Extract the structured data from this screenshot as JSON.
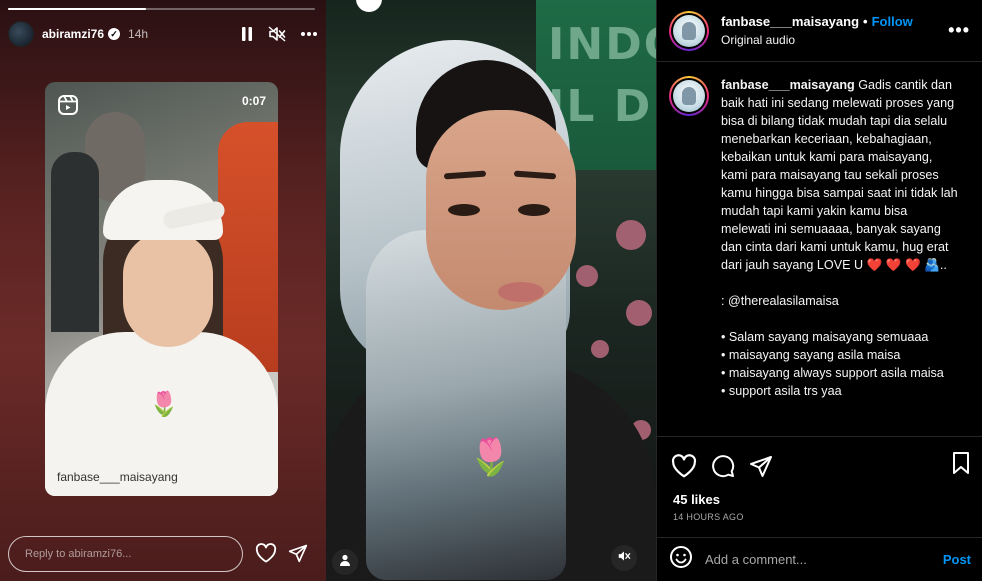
{
  "story": {
    "progress": 0.45,
    "username": "abiramzi76",
    "verified_mark": "✓",
    "time_ago": "14h",
    "controls": [
      "pause-icon",
      "muted-icon",
      "more-icon"
    ],
    "reel": {
      "duration": "0:07",
      "credit": "fanbase___maisayang",
      "sticker": "🌷"
    },
    "reply_placeholder": "Reply to abiramzi76..."
  },
  "media": {
    "sign_text": "INDO\nIL D",
    "sticker": "🌷"
  },
  "post": {
    "username": "fanbase___maisayang",
    "separator": "•",
    "follow_label": "Follow",
    "audio": "Original audio",
    "more": "•••",
    "caption": {
      "username": "fanbase___maisayang",
      "text": "Gadis cantik dan baik hati ini sedang melewati proses yang bisa di bilang tidak mudah tapi dia selalu menebarkan keceriaan, kebahagiaan, kebaikan untuk kami para maisayang, kami para maisayang tau sekali proses kamu hingga bisa sampai saat ini tidak lah mudah tapi kami yakin kamu bisa melewati ini semuaaaa, banyak sayang dan cinta dari kami untuk kamu, hug erat dari jauh sayang LOVE U ❤️ ❤️ ❤️ 🫂..",
      "mention_line": ": @therealasilamaisa",
      "bullets": [
        "• Salam sayang maisayang semuaaa",
        "• maisayang sayang asila maisa",
        "• maisayang always support asila maisa",
        "• support asila trs yaa"
      ]
    },
    "likes": "45 likes",
    "time_ago": "14 HOURS AGO",
    "comment_placeholder": "Add a comment...",
    "post_label": "Post"
  },
  "colors": {
    "accent": "#0095f6",
    "background": "#000000",
    "story_bg": "#6b2b28"
  }
}
